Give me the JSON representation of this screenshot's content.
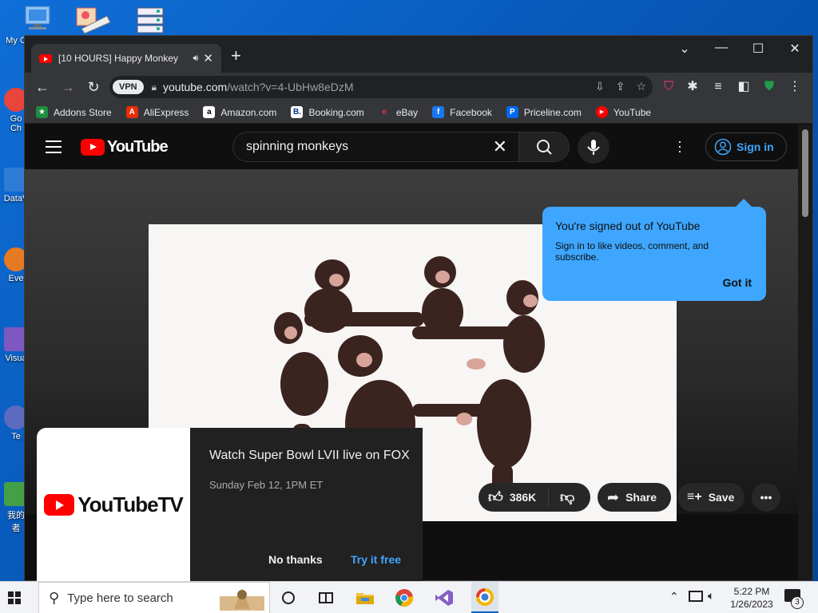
{
  "desktop": {
    "icons": [
      {
        "label": "My C",
        "color": "#4a90d9"
      },
      {
        "label": "Go\nCh",
        "color": "#e8453c"
      },
      {
        "label": "DataV",
        "color": "#2e7bd6"
      },
      {
        "label": "Eve",
        "color": "#e67a22"
      },
      {
        "label": "Visua",
        "color": "#7e57c2"
      },
      {
        "label": "Te",
        "color": "#5c6bc0"
      },
      {
        "label": "我的\n者",
        "color": "#43a047"
      }
    ]
  },
  "browser": {
    "tab": {
      "title": "[10 HOURS] Happy Monkey",
      "audio_icon": "speaker-icon",
      "close": "✕"
    },
    "new_tab": "+",
    "window_controls": [
      "⌄",
      "—",
      "☐",
      "✕"
    ],
    "address": {
      "vpn": "VPN",
      "host": "youtube.com",
      "path": "/watch?v=4-UbHw8eDzM"
    },
    "bookmarks": [
      {
        "label": "Addons Store",
        "icon": "addons-icon",
        "color": "#1e8e3e",
        "glyph": "★"
      },
      {
        "label": "AliExpress",
        "icon": "aliexpress-icon",
        "color": "#e62e04",
        "glyph": "A"
      },
      {
        "label": "Amazon.com",
        "icon": "amazon-icon",
        "color": "#ffffff",
        "glyph": "a"
      },
      {
        "label": "Booking.com",
        "icon": "booking-icon",
        "color": "#ffffff",
        "glyph": "B."
      },
      {
        "label": "eBay",
        "icon": "ebay-icon",
        "color": "#35363a",
        "glyph": "e"
      },
      {
        "label": "Facebook",
        "icon": "facebook-icon",
        "color": "#1877f2",
        "glyph": "f"
      },
      {
        "label": "Priceline.com",
        "icon": "priceline-icon",
        "color": "#0068ef",
        "glyph": "P"
      },
      {
        "label": "YouTube",
        "icon": "youtube-icon",
        "color": "#ff0000",
        "glyph": "▶"
      }
    ]
  },
  "youtube": {
    "logo_text": "YouTube",
    "search_query": "spinning monkeys",
    "signin_label": "Sign in",
    "tooltip": {
      "title": "You're signed out of YouTube",
      "body": "Sign in to like videos, comment, and subscribe.",
      "button": "Got it"
    },
    "actions": {
      "likes": "386K",
      "share": "Share",
      "save": "Save"
    },
    "promo": {
      "logo_text": "YouTubeTV",
      "title": "Watch Super Bowl LVII live on FOX",
      "subtitle": "Sunday Feb 12, 1PM ET",
      "dismiss": "No thanks",
      "cta": "Try it free"
    }
  },
  "taskbar": {
    "search_placeholder": "Type here to search",
    "time": "5:22 PM",
    "date": "1/26/2023",
    "notifications": "3"
  }
}
